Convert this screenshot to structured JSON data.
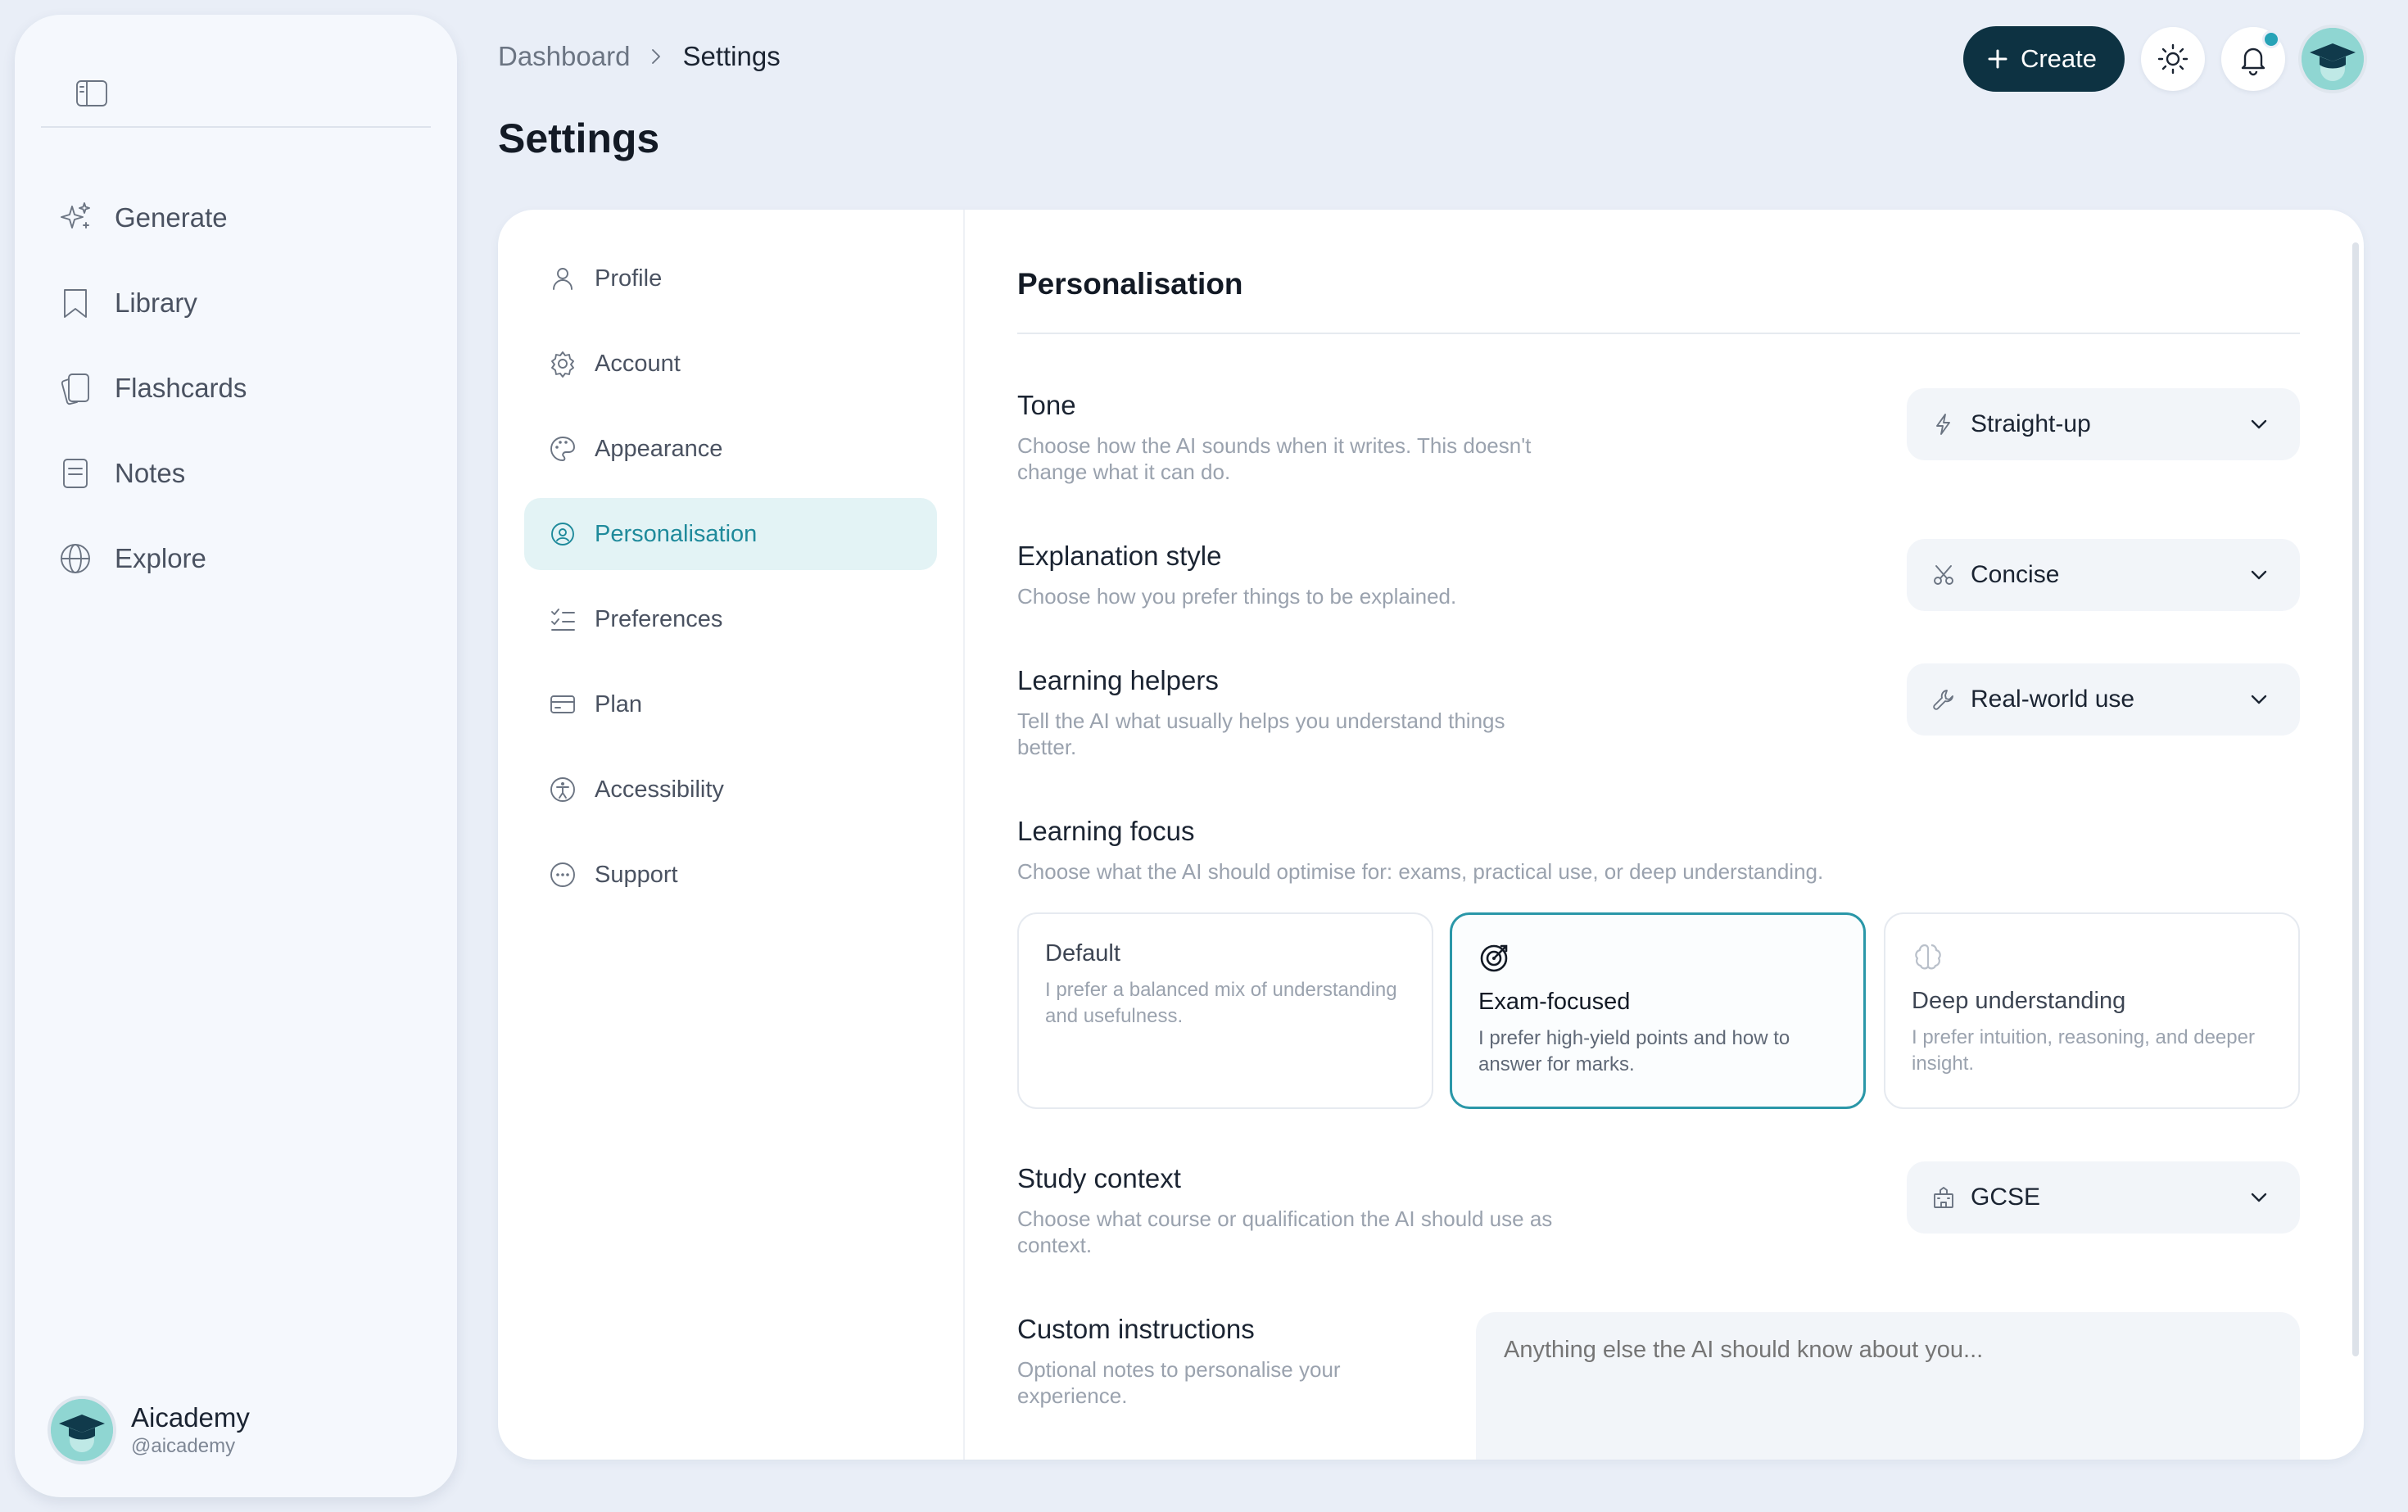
{
  "sidebar": {
    "items": [
      {
        "label": "Generate",
        "icon": "sparkles-icon"
      },
      {
        "label": "Library",
        "icon": "bookmark-icon"
      },
      {
        "label": "Flashcards",
        "icon": "cards-icon"
      },
      {
        "label": "Notes",
        "icon": "notes-icon"
      },
      {
        "label": "Explore",
        "icon": "globe-icon"
      }
    ],
    "user": {
      "name": "Aicademy",
      "handle": "@aicademy"
    }
  },
  "header": {
    "breadcrumb": {
      "home": "Dashboard",
      "current": "Settings"
    },
    "title": "Settings",
    "create_label": "Create"
  },
  "settings_nav": {
    "items": [
      {
        "label": "Profile",
        "icon": "user-icon"
      },
      {
        "label": "Account",
        "icon": "gear-icon"
      },
      {
        "label": "Appearance",
        "icon": "palette-icon"
      },
      {
        "label": "Personalisation",
        "icon": "personalisation-icon",
        "active": true
      },
      {
        "label": "Preferences",
        "icon": "checklist-icon"
      },
      {
        "label": "Plan",
        "icon": "credit-card-icon"
      },
      {
        "label": "Accessibility",
        "icon": "accessibility-icon"
      },
      {
        "label": "Support",
        "icon": "chat-icon"
      }
    ]
  },
  "personalisation": {
    "title": "Personalisation",
    "tone": {
      "label": "Tone",
      "desc": "Choose how the AI sounds when it writes. This doesn't change what it can do.",
      "value": "Straight-up"
    },
    "explanation": {
      "label": "Explanation style",
      "desc": "Choose how you prefer things to be explained.",
      "value": "Concise"
    },
    "helpers": {
      "label": "Learning helpers",
      "desc": "Tell the AI what usually helps you understand things better.",
      "value": "Real-world use"
    },
    "focus": {
      "label": "Learning focus",
      "desc": "Choose what the AI should optimise for: exams, practical use, or deep understanding.",
      "options": [
        {
          "title": "Default",
          "desc": "I prefer a balanced mix of understanding and usefulness."
        },
        {
          "title": "Exam-focused",
          "desc": "I prefer high-yield points and how to answer for marks.",
          "selected": true
        },
        {
          "title": "Deep understanding",
          "desc": "I prefer intuition, reasoning, and deeper insight."
        }
      ]
    },
    "context": {
      "label": "Study context",
      "desc": "Choose what course or qualification the AI should use as context.",
      "value": "GCSE"
    },
    "custom": {
      "label": "Custom instructions",
      "desc": "Optional notes to personalise your experience.",
      "placeholder": "Anything else the AI should know about you..."
    }
  },
  "colors": {
    "accent": "#1f8a9b",
    "primary": "#0d3242",
    "notification": "#27a3b7"
  }
}
